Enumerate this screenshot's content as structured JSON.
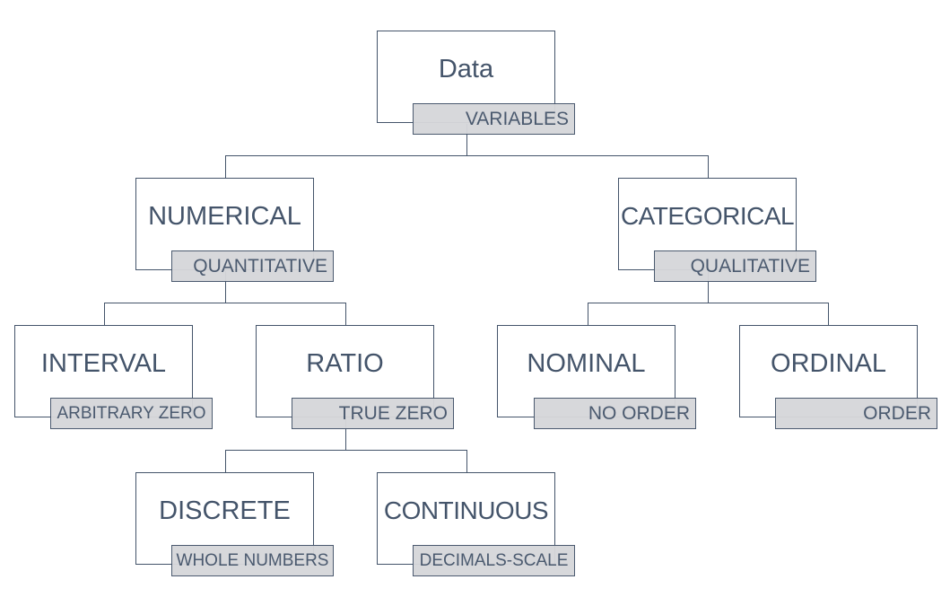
{
  "diagram": {
    "type": "hierarchy",
    "colors": {
      "text": "#44546a",
      "border": "#44546a",
      "tag_fill": "#d6d7da",
      "background": "#ffffff"
    },
    "nodes": {
      "data": {
        "title": "Data",
        "tag": "VARIABLES"
      },
      "numerical": {
        "title": "NUMERICAL",
        "tag": "QUANTITATIVE"
      },
      "categorical": {
        "title": "CATEGORICAL",
        "tag": "QUALITATIVE"
      },
      "interval": {
        "title": "INTERVAL",
        "tag": "ARBITRARY ZERO"
      },
      "ratio": {
        "title": "RATIO",
        "tag": "TRUE ZERO"
      },
      "nominal": {
        "title": "NOMINAL",
        "tag": "NO ORDER"
      },
      "ordinal": {
        "title": "ORDINAL",
        "tag": "ORDER"
      },
      "discrete": {
        "title": "DISCRETE",
        "tag": "WHOLE NUMBERS"
      },
      "continuous": {
        "title": "CONTINUOUS",
        "tag": "DECIMALS-SCALE"
      }
    },
    "edges": [
      [
        "data",
        "numerical"
      ],
      [
        "data",
        "categorical"
      ],
      [
        "numerical",
        "interval"
      ],
      [
        "numerical",
        "ratio"
      ],
      [
        "categorical",
        "nominal"
      ],
      [
        "categorical",
        "ordinal"
      ],
      [
        "ratio",
        "discrete"
      ],
      [
        "ratio",
        "continuous"
      ]
    ]
  }
}
